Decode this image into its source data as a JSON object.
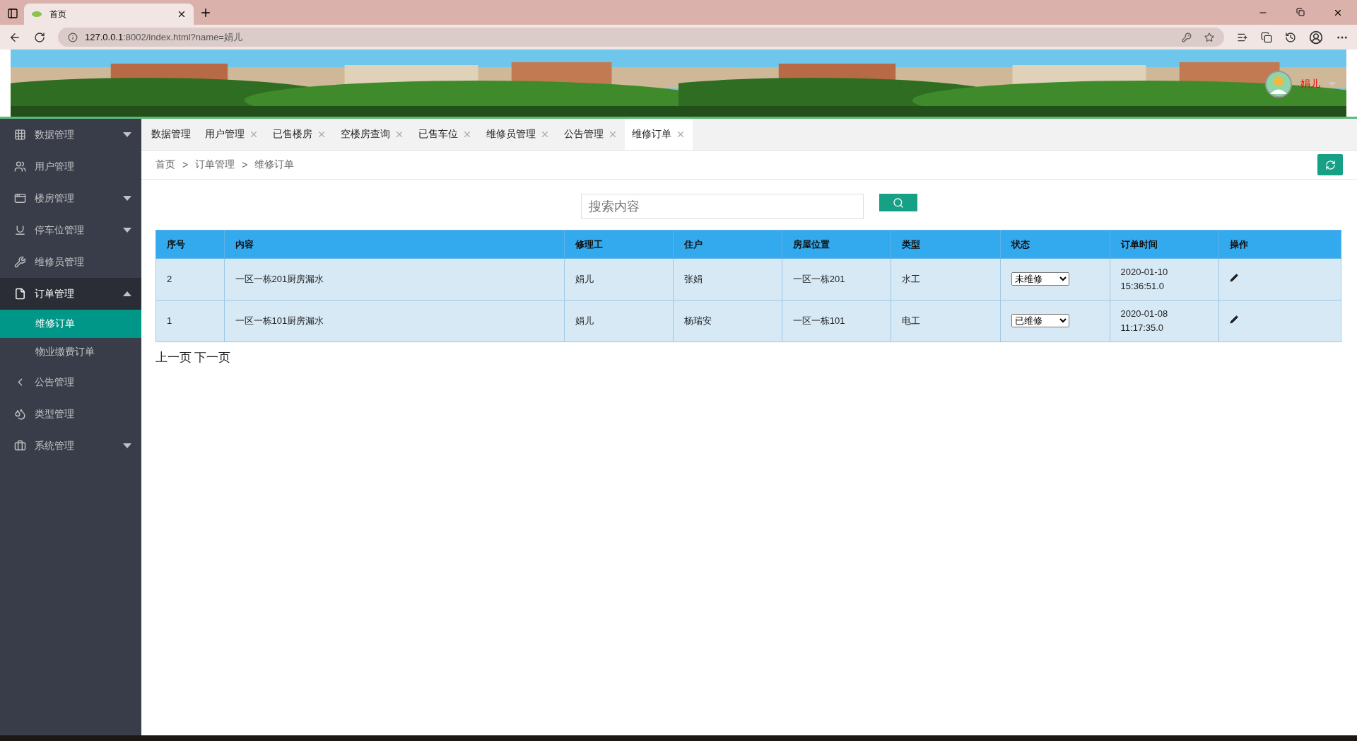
{
  "browser": {
    "tab_title": "首页",
    "url_host": "127.0.0.1",
    "url_rest": ":8002/index.html?name=娟儿"
  },
  "header": {
    "user_name": "娟儿"
  },
  "sidebar": {
    "items": [
      {
        "label": "数据管理",
        "expanded": false,
        "has_caret": true
      },
      {
        "label": "用户管理",
        "expanded": false,
        "has_caret": false
      },
      {
        "label": "楼房管理",
        "expanded": false,
        "has_caret": true
      },
      {
        "label": "停车位管理",
        "expanded": false,
        "has_caret": true
      },
      {
        "label": "维修员管理",
        "expanded": false,
        "has_caret": false
      },
      {
        "label": "订单管理",
        "expanded": true,
        "has_caret": true,
        "children": [
          {
            "label": "维修订单",
            "selected": true
          },
          {
            "label": "物业缴费订单",
            "selected": false
          }
        ]
      },
      {
        "label": "公告管理",
        "expanded": false,
        "has_caret": false
      },
      {
        "label": "类型管理",
        "expanded": false,
        "has_caret": false
      },
      {
        "label": "系统管理",
        "expanded": false,
        "has_caret": true
      }
    ]
  },
  "tabs": [
    {
      "label": "数据管理",
      "closable": false,
      "selected": false
    },
    {
      "label": "用户管理",
      "closable": true,
      "selected": false
    },
    {
      "label": "已售楼房",
      "closable": true,
      "selected": false
    },
    {
      "label": "空楼房查询",
      "closable": true,
      "selected": false
    },
    {
      "label": "已售车位",
      "closable": true,
      "selected": false
    },
    {
      "label": "维修员管理",
      "closable": true,
      "selected": false
    },
    {
      "label": "公告管理",
      "closable": true,
      "selected": false
    },
    {
      "label": "维修订单",
      "closable": true,
      "selected": true
    }
  ],
  "breadcrumb": {
    "items": [
      "首页",
      "订单管理",
      "维修订单"
    ],
    "separator": ">"
  },
  "search": {
    "placeholder": "搜索内容"
  },
  "table": {
    "columns": [
      "序号",
      "内容",
      "修理工",
      "住户",
      "房屋位置",
      "类型",
      "状态",
      "订单时间",
      "操作"
    ],
    "rows": [
      {
        "no": "2",
        "content": "一区一栋201厨房漏水",
        "worker": "娟儿",
        "resident": "张娟",
        "location": "一区一栋201",
        "type": "水工",
        "status": "未维修",
        "date": "2020-01-10",
        "time": "15:36:51.0"
      },
      {
        "no": "1",
        "content": "一区一栋101厨房漏水",
        "worker": "娟儿",
        "resident": "杨瑞安",
        "location": "一区一栋101",
        "type": "电工",
        "status": "已维修",
        "date": "2020-01-08",
        "time": "11:17:35.0"
      }
    ]
  },
  "pager": {
    "prev": "上一页",
    "next": "下一页"
  }
}
